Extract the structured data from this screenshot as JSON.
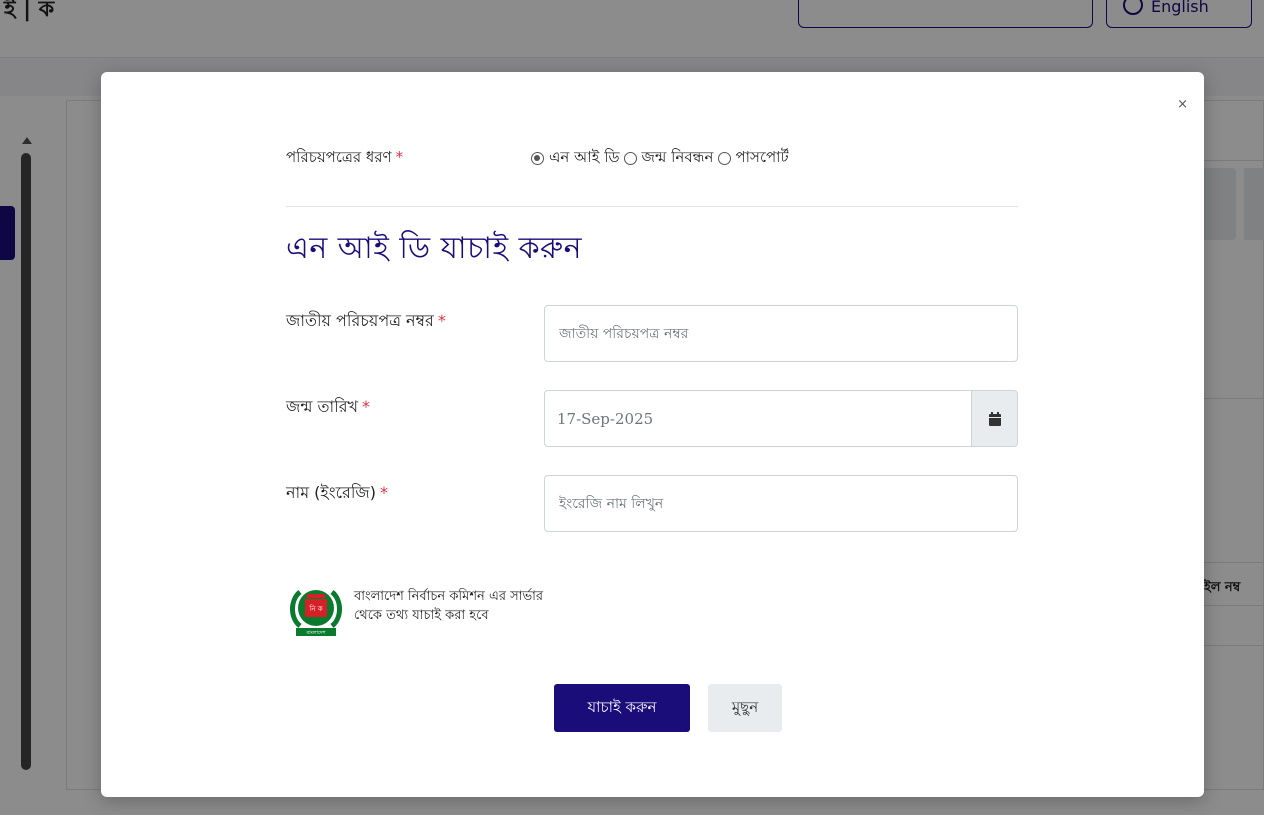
{
  "background": {
    "header_logo_text": "ই | ক",
    "language_button": "English",
    "side_label_mobile": "াইল নম্ব"
  },
  "modal": {
    "close_label": "×",
    "id_type": {
      "label": "পরিচয়পত্রের ধরণ",
      "required_mark": "*",
      "options": [
        "এন আই ডি",
        "জন্ম নিবন্ধন",
        "পাসপোর্ট"
      ],
      "selected": "এন আই ডি"
    },
    "heading": "এন আই ডি যাচাই করুন",
    "nid_field": {
      "label": "জাতীয় পরিচয়পত্র নম্বর",
      "required_mark": "*",
      "placeholder": "জাতীয় পরিচয়পত্র নম্বর",
      "value": ""
    },
    "dob_field": {
      "label": "জন্ম তারিখ",
      "required_mark": "*",
      "value": "17-Sep-2025",
      "icon": "calendar-icon"
    },
    "name_field": {
      "label": "নাম (ইংরেজি)",
      "required_mark": "*",
      "placeholder": "ইংরেজি নাম লিখুন",
      "value": ""
    },
    "ec_notice": {
      "line1": "বাংলাদেশ নির্বাচন কমিশন এর সার্ভার",
      "line2": "থেকে তথ্য যাচাই করা হবে",
      "logo_text": "নি ক",
      "logo_banner": "বাংলাদেশ"
    },
    "buttons": {
      "verify": "যাচাই করুন",
      "clear": "মুছুন"
    }
  },
  "colors": {
    "primary": "#1a0d7a",
    "required": "#dc3545",
    "ec_green": "#0a7a2f",
    "ec_red": "#d61f26"
  }
}
